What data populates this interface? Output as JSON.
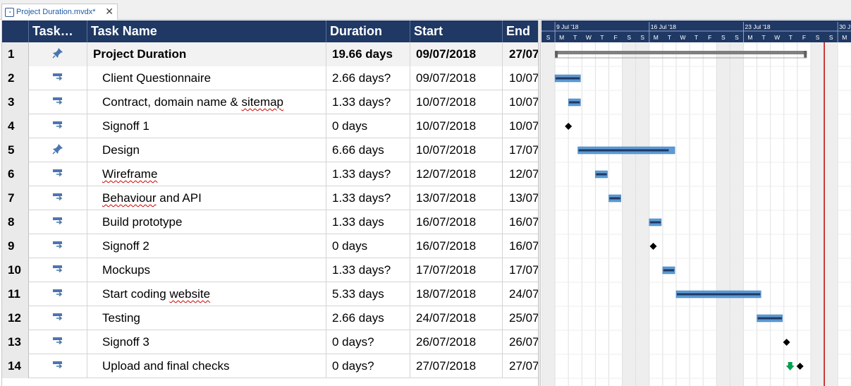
{
  "tab": {
    "title": "Project Duration.mvdx*",
    "close": "✕"
  },
  "columns": {
    "num": "",
    "mode": "Task…",
    "name": "Task Name",
    "duration": "Duration",
    "start": "Start",
    "end": "End"
  },
  "rows": [
    {
      "id": "1",
      "mode": "pin",
      "name": "Project Duration",
      "duration": "19.66 days",
      "start": "09/07/2018",
      "end": "27/07",
      "summary": true
    },
    {
      "id": "2",
      "mode": "auto",
      "name": "Client Questionnaire",
      "duration": "2.66 days?",
      "start": "09/07/2018",
      "end": "10/07"
    },
    {
      "id": "3",
      "mode": "auto",
      "name": "Contract, domain name & sitemap",
      "duration": "1.33 days?",
      "start": "10/07/2018",
      "end": "10/07"
    },
    {
      "id": "4",
      "mode": "auto",
      "name": "Signoff 1",
      "duration": "0 days",
      "start": "10/07/2018",
      "end": "10/07"
    },
    {
      "id": "5",
      "mode": "pin",
      "name": "Design",
      "duration": "6.66 days",
      "start": "10/07/2018",
      "end": "17/07"
    },
    {
      "id": "6",
      "mode": "auto",
      "name": "Wireframe",
      "duration": "1.33 days?",
      "start": "12/07/2018",
      "end": "12/07"
    },
    {
      "id": "7",
      "mode": "auto",
      "name": "Behaviour and API",
      "duration": "1.33 days?",
      "start": "13/07/2018",
      "end": "13/07"
    },
    {
      "id": "8",
      "mode": "auto",
      "name": "Build prototype",
      "duration": "1.33 days",
      "start": "16/07/2018",
      "end": "16/07"
    },
    {
      "id": "9",
      "mode": "auto",
      "name": "Signoff 2",
      "duration": "0 days",
      "start": "16/07/2018",
      "end": "16/07"
    },
    {
      "id": "10",
      "mode": "auto",
      "name": "Mockups",
      "duration": "1.33 days?",
      "start": "17/07/2018",
      "end": "17/07"
    },
    {
      "id": "11",
      "mode": "auto",
      "name": "Start coding website",
      "duration": "5.33 days",
      "start": "18/07/2018",
      "end": "24/07"
    },
    {
      "id": "12",
      "mode": "auto",
      "name": "Testing",
      "duration": "2.66 days",
      "start": "24/07/2018",
      "end": "25/07"
    },
    {
      "id": "13",
      "mode": "auto",
      "name": "Signoff 3",
      "duration": "0 days?",
      "start": "26/07/2018",
      "end": "26/07"
    },
    {
      "id": "14",
      "mode": "auto",
      "name": "Upload and final checks",
      "duration": "0 days?",
      "start": "27/07/2018",
      "end": "27/07"
    }
  ],
  "gantt": {
    "weeks": [
      "9 Jul '18",
      "16 Jul '18",
      "23 Jul '18",
      "30 J"
    ],
    "days": [
      "S",
      "M",
      "T",
      "W",
      "T",
      "F",
      "S",
      "S",
      "M",
      "T",
      "W",
      "T",
      "F",
      "S",
      "S",
      "M",
      "T",
      "W",
      "T",
      "F",
      "S",
      "S",
      "M"
    ],
    "first_day": "08/07/2018",
    "tasks": [
      {
        "row": 1,
        "type": "summary",
        "start": 9.0,
        "end": 27.7
      },
      {
        "row": 2,
        "type": "bar",
        "start": 9.0,
        "end": 10.9
      },
      {
        "row": 3,
        "type": "bar",
        "start": 10.0,
        "end": 10.9
      },
      {
        "row": 4,
        "type": "milestone",
        "start": 10.0
      },
      {
        "row": 5,
        "type": "pinned",
        "start": 10.7,
        "end": 17.9,
        "progress_end": 17.5
      },
      {
        "row": 6,
        "type": "bar",
        "start": 12.0,
        "end": 12.9
      },
      {
        "row": 7,
        "type": "bar",
        "start": 13.0,
        "end": 13.9
      },
      {
        "row": 8,
        "type": "bar",
        "start": 16.0,
        "end": 16.9
      },
      {
        "row": 9,
        "type": "milestone",
        "start": 16.3
      },
      {
        "row": 10,
        "type": "bar",
        "start": 17.0,
        "end": 17.9
      },
      {
        "row": 11,
        "type": "bar",
        "start": 18.0,
        "end": 24.3
      },
      {
        "row": 12,
        "type": "bar",
        "start": 24.0,
        "end": 25.9
      },
      {
        "row": 13,
        "type": "milestone",
        "start": 26.2
      },
      {
        "row": 14,
        "type": "milestone",
        "start": 27.2,
        "deadline_arrow": true
      }
    ],
    "today_day": 29.0,
    "colors": {
      "header": "#1f3864",
      "bar": "#5b9bd5",
      "bar_inner": "#1f3864",
      "summary": "#7f7f7f",
      "weekend": "#eeeeee",
      "today": "#c00000",
      "deadline": "#00a050"
    }
  }
}
